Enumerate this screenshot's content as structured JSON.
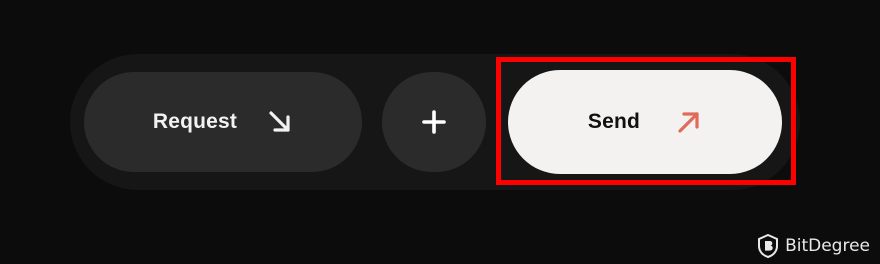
{
  "actions": {
    "request_label": "Request",
    "add_symbol": "+",
    "send_label": "Send"
  },
  "icons": {
    "request": "arrow-down-right-icon",
    "add": "plus-icon",
    "send": "arrow-up-right-icon",
    "watermark": "bitdegree-logo-icon"
  },
  "colors": {
    "background": "#0c0c0c",
    "bar": "#161616",
    "button_dark": "#2b2b2b",
    "button_light": "#f4f2f1",
    "send_arrow": "#e06b5a",
    "highlight": "#ff0000"
  },
  "watermark": {
    "text": "BitDegree"
  }
}
